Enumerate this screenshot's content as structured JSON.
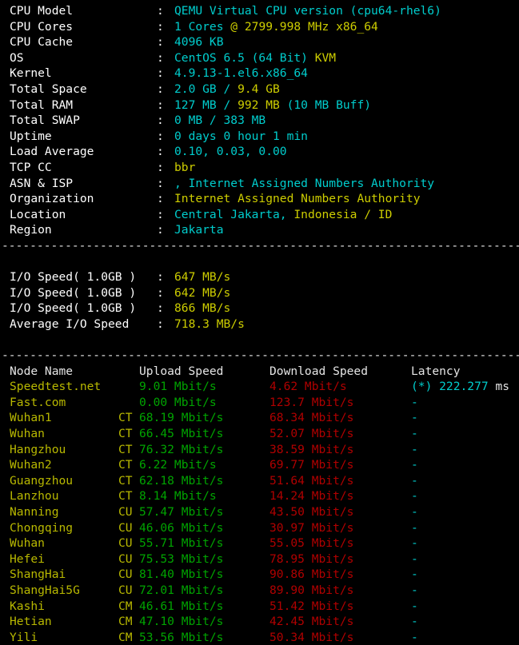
{
  "terminal": {
    "background": "#000000",
    "colors": {
      "white": "#e5e5e5",
      "cyan": "#00cdcd",
      "yellow": "#cdcd00",
      "green": "#00a400",
      "red": "#b00000",
      "olive": "#b8b800"
    },
    "divider": "-------------------------------------------------------------------------------"
  },
  "sysinfo": [
    {
      "label": "CPU Model",
      "v1": "QEMU Virtual CPU version (cpu64-rhel6)",
      "v2": "",
      "v3": ""
    },
    {
      "label": "CPU Cores",
      "v1": "1 Cores ",
      "v2": "@ 2799.998 MHz x86_64",
      "v3": ""
    },
    {
      "label": "CPU Cache",
      "v1": "4096 KB",
      "v2": "",
      "v3": ""
    },
    {
      "label": "OS",
      "v1": "CentOS 6.5 (64 Bit) ",
      "v2": "KVM",
      "v3": ""
    },
    {
      "label": "Kernel",
      "v1": "4.9.13-1.el6.x86_64",
      "v2": "",
      "v3": ""
    },
    {
      "label": "Total Space",
      "v1": "2.0 GB / ",
      "v2": "9.4 GB",
      "v3": ""
    },
    {
      "label": "Total RAM",
      "v1": "127 MB / ",
      "v2": "992 MB",
      "v3": " (10 MB Buff)"
    },
    {
      "label": "Total SWAP",
      "v1": "0 MB / 383 MB",
      "v2": "",
      "v3": ""
    },
    {
      "label": "Uptime",
      "v1": "0 days 0 hour 1 min",
      "v2": "",
      "v3": ""
    },
    {
      "label": "Load Average",
      "v1": "0.10, 0.03, 0.00",
      "v2": "",
      "v3": ""
    },
    {
      "label": "TCP CC",
      "v1": "",
      "v2": "bbr",
      "v3": ""
    },
    {
      "label": "ASN & ISP",
      "v1": ", Internet Assigned Numbers Authority",
      "v2": "",
      "v3": ""
    },
    {
      "label": "Organization",
      "v1": "",
      "v2": "Internet Assigned Numbers Authority",
      "v3": ""
    },
    {
      "label": "Location",
      "v1": "Central Jakarta, ",
      "v2": "Indonesia / ID",
      "v3": ""
    },
    {
      "label": "Region",
      "v1": "Jakarta",
      "v2": "",
      "v3": ""
    }
  ],
  "iospeed": [
    {
      "label": "I/O Speed( 1.0GB )",
      "value": "647 MB/s"
    },
    {
      "label": "I/O Speed( 1.0GB )",
      "value": "642 MB/s"
    },
    {
      "label": "I/O Speed( 1.0GB )",
      "value": "866 MB/s"
    },
    {
      "label": "Average I/O Speed",
      "value": "718.3 MB/s"
    }
  ],
  "speedtest": {
    "headers": {
      "node": "Node Name",
      "isp": "",
      "upload": "Upload Speed",
      "download": "Download Speed",
      "latency": "Latency"
    },
    "rows": [
      {
        "node": "Speedtest.net",
        "isp": "",
        "upload": "9.01 Mbit/s",
        "download": "4.62 Mbit/s",
        "latency": "(*) 222.277",
        "latency_unit": " ms"
      },
      {
        "node": "Fast.com",
        "isp": "",
        "upload": "0.00 Mbit/s",
        "download": "123.7 Mbit/s",
        "latency": "-",
        "latency_unit": ""
      },
      {
        "node": "Wuhan1",
        "isp": "CT",
        "upload": "68.19 Mbit/s",
        "download": "68.34 Mbit/s",
        "latency": "-",
        "latency_unit": ""
      },
      {
        "node": "Wuhan",
        "isp": "CT",
        "upload": "66.45 Mbit/s",
        "download": "52.07 Mbit/s",
        "latency": "-",
        "latency_unit": ""
      },
      {
        "node": "Hangzhou",
        "isp": "CT",
        "upload": "76.32 Mbit/s",
        "download": "38.59 Mbit/s",
        "latency": "-",
        "latency_unit": ""
      },
      {
        "node": "Wuhan2",
        "isp": "CT",
        "upload": "6.22 Mbit/s",
        "download": "69.77 Mbit/s",
        "latency": "-",
        "latency_unit": ""
      },
      {
        "node": "Guangzhou",
        "isp": "CT",
        "upload": "62.18 Mbit/s",
        "download": "51.64 Mbit/s",
        "latency": "-",
        "latency_unit": ""
      },
      {
        "node": "Lanzhou",
        "isp": "CT",
        "upload": "8.14 Mbit/s",
        "download": "14.24 Mbit/s",
        "latency": "-",
        "latency_unit": ""
      },
      {
        "node": "Nanning",
        "isp": "CU",
        "upload": "57.47 Mbit/s",
        "download": "43.50 Mbit/s",
        "latency": "-",
        "latency_unit": ""
      },
      {
        "node": "Chongqing",
        "isp": "CU",
        "upload": "46.06 Mbit/s",
        "download": "30.97 Mbit/s",
        "latency": "-",
        "latency_unit": ""
      },
      {
        "node": "Wuhan",
        "isp": "CU",
        "upload": "55.71 Mbit/s",
        "download": "55.05 Mbit/s",
        "latency": "-",
        "latency_unit": ""
      },
      {
        "node": "Hefei",
        "isp": "CU",
        "upload": "75.53 Mbit/s",
        "download": "78.95 Mbit/s",
        "latency": "-",
        "latency_unit": ""
      },
      {
        "node": "ShangHai",
        "isp": "CU",
        "upload": "81.40 Mbit/s",
        "download": "90.86 Mbit/s",
        "latency": "-",
        "latency_unit": ""
      },
      {
        "node": "ShangHai5G",
        "isp": "CU",
        "upload": "72.01 Mbit/s",
        "download": "89.90 Mbit/s",
        "latency": "-",
        "latency_unit": ""
      },
      {
        "node": "Kashi",
        "isp": "CM",
        "upload": "46.61 Mbit/s",
        "download": "51.42 Mbit/s",
        "latency": "-",
        "latency_unit": ""
      },
      {
        "node": "Hetian",
        "isp": "CM",
        "upload": "47.10 Mbit/s",
        "download": "42.45 Mbit/s",
        "latency": "-",
        "latency_unit": ""
      },
      {
        "node": "Yili",
        "isp": "CM",
        "upload": "53.56 Mbit/s",
        "download": "50.34 Mbit/s",
        "latency": "-",
        "latency_unit": ""
      }
    ]
  }
}
